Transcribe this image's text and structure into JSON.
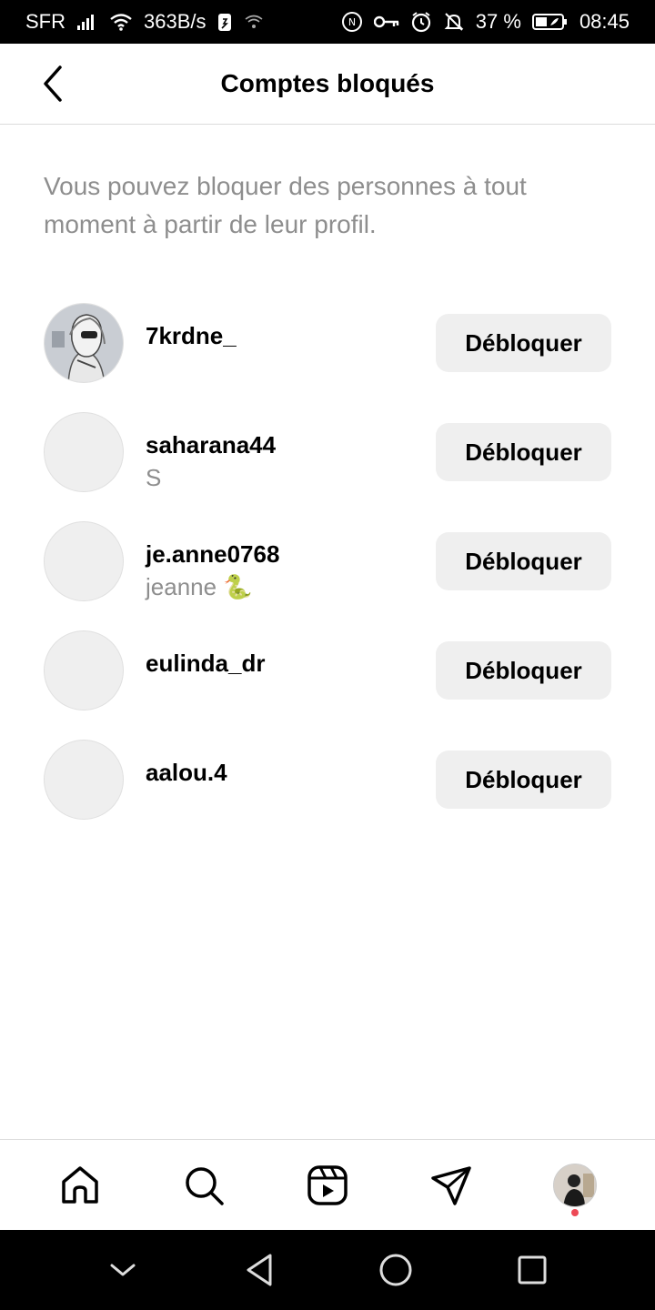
{
  "status_bar": {
    "carrier": "SFR",
    "network_speed": "363B/s",
    "battery_percent": "37 %",
    "time": "08:45"
  },
  "header": {
    "title": "Comptes bloqués"
  },
  "info": {
    "text": "Vous pouvez bloquer des personnes à tout moment à partir de leur profil."
  },
  "blocked_accounts": [
    {
      "username": "7krdne_",
      "full_name": "",
      "button_label": "Débloquer",
      "has_photo": true
    },
    {
      "username": "saharana44",
      "full_name": "S",
      "button_label": "Débloquer",
      "has_photo": false
    },
    {
      "username": "je.anne0768",
      "full_name": "jeanne 🐍",
      "button_label": "Débloquer",
      "has_photo": false
    },
    {
      "username": "eulinda_dr",
      "full_name": "",
      "button_label": "Débloquer",
      "has_photo": false
    },
    {
      "username": "aalou.4",
      "full_name": "",
      "button_label": "Débloquer",
      "has_photo": false
    }
  ],
  "bottom_nav": {
    "items": [
      "home-icon",
      "search-icon",
      "reels-icon",
      "direct-message-icon",
      "profile-avatar"
    ],
    "notification_dot_color": "#ed4956"
  },
  "colors": {
    "secondary_text": "#8e8e8e",
    "button_bg": "#efefef"
  }
}
